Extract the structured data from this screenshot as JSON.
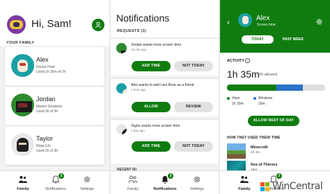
{
  "family": {
    "greeting": "Hi, Sam!",
    "section_label": "YOUR FAMILY",
    "members": [
      {
        "name": "Alex",
        "tag": "Doctor Hoot",
        "used": "Used 1h 35m of 2h"
      },
      {
        "name": "Jordan",
        "tag": "Master Greatsire",
        "used": "Used 3h of 3h"
      },
      {
        "name": "Taylor",
        "tag": "Ninja Ichi",
        "used": "Used 2h of 3h"
      }
    ]
  },
  "nav": {
    "family": "Family",
    "notifications": "Notifications",
    "settings": "Settings",
    "badge": "3"
  },
  "notifications": {
    "title": "Notifications",
    "requests_label": "REQUESTS (3)",
    "requests": [
      {
        "message": "Jordan wants more screen time",
        "time": "16 min ago",
        "primary": "ADD TIME",
        "secondary": "NOT TODAY"
      },
      {
        "message": "Alex wants to add Last Roar as a friend",
        "time": "1 hour ago",
        "primary": "ALLOW",
        "secondary": "REVIEW"
      },
      {
        "message": "Taylor wants more screen time",
        "time": "1 day ago",
        "primary": "ADD TIME",
        "secondary": "NOT TODAY"
      }
    ],
    "recent_label": "RECENT (6)"
  },
  "child": {
    "name": "Alex",
    "subtitle": "Screen time",
    "tabs": [
      "TODAY",
      "PAST WEEK"
    ],
    "activity_label": "ACTIVITY",
    "total": "1h 35m",
    "allowed": "2h allowed",
    "usage": [
      {
        "device": "Xbox",
        "time": "1h 20m",
        "fraction": 0.5,
        "color": "#107c10"
      },
      {
        "device": "Windows",
        "time": "16m",
        "fraction": 0.27,
        "color": "#2a73c7"
      }
    ],
    "allow_button": "ALLOW REST OF DAY",
    "games_label": "HOW THEY USED THEIR TIME",
    "games": [
      {
        "name": "Minecraft",
        "time": "1h 4m"
      },
      {
        "name": "Sea of Thieves",
        "time": "16m"
      }
    ]
  },
  "watermark": "WinCentral"
}
